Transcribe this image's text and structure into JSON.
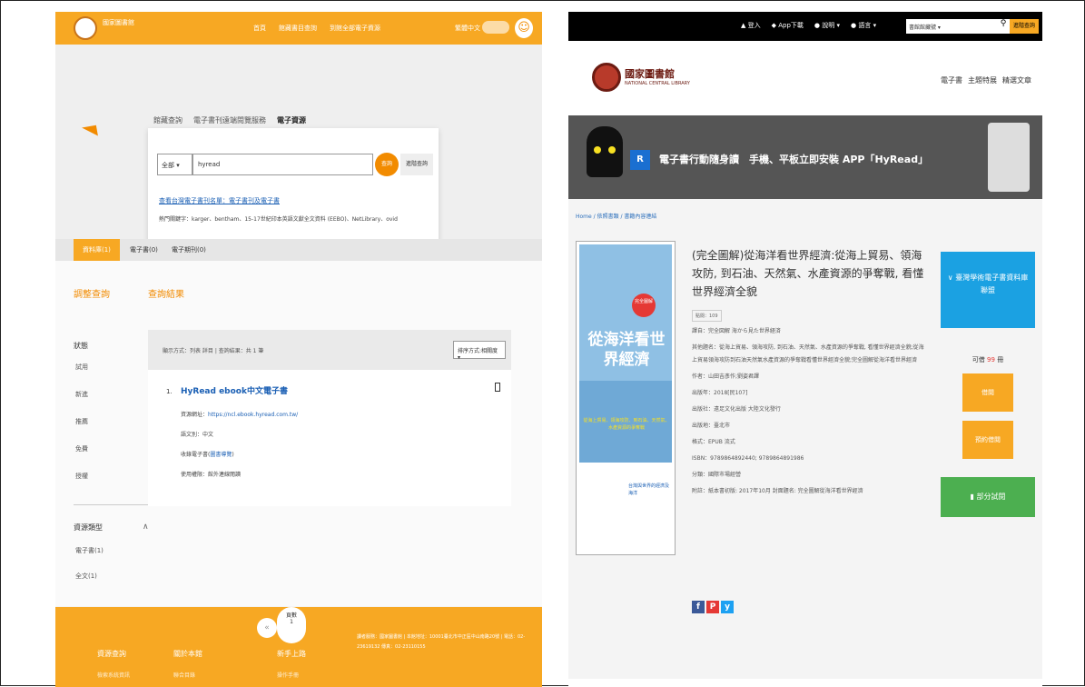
{
  "left": {
    "topnav": [
      "首頁",
      "館藏書目查詢",
      "到館全部電子資源"
    ],
    "lang": "繁體中文",
    "user_icon": "user-icon",
    "tabs": [
      "館藏查詢",
      "電子書刊遠端閱覽服務",
      "電子資源"
    ],
    "search": {
      "scope": "全部",
      "query": "hyread",
      "go": "查詢",
      "advanced": "進階查詢",
      "link": "查看台灣電子書刊名單：電子書刊及電子書",
      "hot": "熱門關鍵字：karger、bentham、15-17世紀印本英語文獻全文資料 (EEBO)、NetLibrary、ovid"
    },
    "result_tabs": [
      "資料庫(1)",
      "電子書(0)",
      "電子期刊(0)"
    ],
    "adjust_title": "調整查詢",
    "filters": {
      "status_title": "狀態",
      "status_items": [
        "試用",
        "新進",
        "推薦",
        "免費",
        "授權"
      ],
      "type_title": "資源類型",
      "type_items": [
        "電子書(1)",
        "全文(1)"
      ]
    },
    "results_title": "查詢結果",
    "sort": {
      "label": "顯示方式：列表 詳目 | 查詢結果：共 1 筆",
      "select": "排序方式:相關度"
    },
    "item": {
      "no": "1.",
      "title": "HyRead ebook中文電子書",
      "url_label": "資源網址：",
      "url": "https://ncl.ebook.hyread.com.tw/",
      "lang": "語文別：中文",
      "type_label": "收錄電子書(",
      "type_link": "圖書導覽",
      "type_end": ")",
      "access": "使用權限：館外連線閱讀"
    },
    "footer": {
      "prev": "«",
      "page_label": "頁數",
      "page_no": "1",
      "cols": [
        "資源查詢",
        "關於本館",
        "新手上路"
      ],
      "subs": [
        "檢索系統資訊",
        "聯合目錄",
        "操作手冊"
      ],
      "info": "讀者服務：國家圖書館 | 本館地址：10001臺北市中正區中山南路20號 | 電話：02-23619132 傳真：02-23110155"
    }
  },
  "right": {
    "topnav": [
      "登入",
      "App下載",
      "說明",
      "語言"
    ],
    "scope": "書館館藏號",
    "adv": "進階查詢",
    "logo_cn": "國家圖書館",
    "logo_en": "NATIONAL CENTRAL LIBRARY",
    "nav": [
      "電子書",
      "主題特展",
      "精選文章"
    ],
    "banner": "電子書行動隨身讀　手機、平板立即安裝 APP「HyRead」",
    "breadcrumb": "Home / 依照書類 / 書籍內容連結",
    "cover": {
      "badge": "完全圖解",
      "title": "從海洋看世界經濟",
      "sub": "從海上貿易、領海攻防、到石油、天然氣、水產資源的爭奪戰",
      "bottom": "台灣與世界的經濟及海洋"
    },
    "title": "(完全圖解)從海洋看世界經濟:從海上貿易、領海攻防, 到石油、天然氣、水產資源的爭奪戰, 看懂世界經濟全貌",
    "tag": "點閱：109",
    "fields": [
      "譯自：完全図解 海から見た世界経済",
      "其他題名：從海上貿易、領海攻防, 到石油、天然氣、水產資源的爭奪戰, 看懂世界經濟全貌;從海上貿易領海攻防到石油天然氣水產資源的爭奪戰看懂世界經濟全貌;完全圖解從海洋看世界經濟",
      "作者：山田吉彥作;劉姿君譯",
      "出版年：2018[民107]",
      "出版社：遠足文化出版 大陸文化發行",
      "出版地：臺北市",
      "格式：EPUB 流式",
      "ISBN：9789864892440; 9789864891986",
      "分類：國際市場經營",
      "附註：紙本書初版: 2017年10月 封面題名: 完全圖解從海洋看世界經濟"
    ],
    "social": [
      "f",
      "P",
      "y"
    ],
    "side": {
      "blue": "∨ 臺灣學術電子書資料庫聯盟",
      "avail_label": "可借",
      "avail_n": "99",
      "avail_unit": "冊",
      "borrow": "借閱",
      "reserve": "預約借閱",
      "trial": "部分試閱"
    }
  }
}
